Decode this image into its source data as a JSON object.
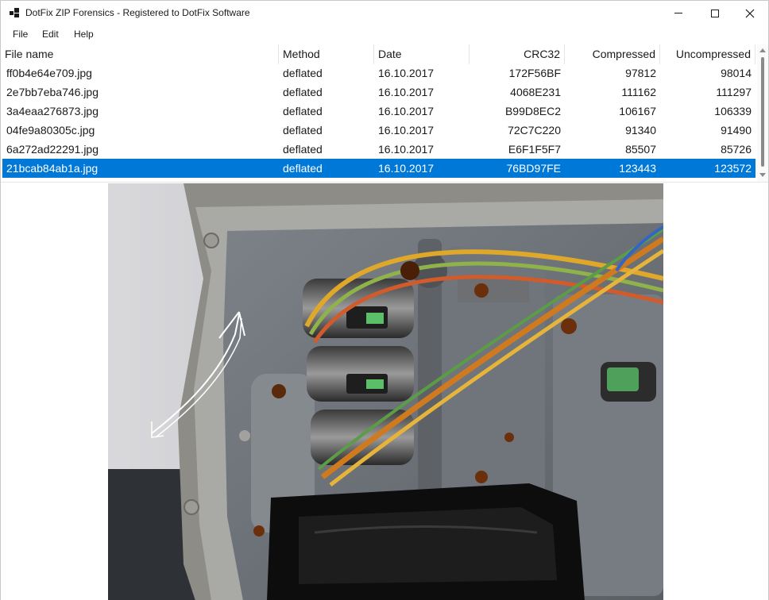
{
  "window": {
    "title": "DotFix ZIP Forensics - Registered to DotFix Software"
  },
  "menu": {
    "items": [
      "File",
      "Edit",
      "Help"
    ]
  },
  "list": {
    "columns": [
      "File name",
      "Method",
      "Date",
      "CRC32",
      "Compressed",
      "Uncompressed"
    ],
    "rows": [
      {
        "name": "ff0b4e64e709.jpg",
        "method": "deflated",
        "date": "16.10.2017",
        "crc": "172F56BF",
        "compressed": "97812",
        "uncompressed": "98014"
      },
      {
        "name": "2e7bb7eba746.jpg",
        "method": "deflated",
        "date": "16.10.2017",
        "crc": "4068E231",
        "compressed": "111162",
        "uncompressed": "111297"
      },
      {
        "name": "3a4eaa276873.jpg",
        "method": "deflated",
        "date": "16.10.2017",
        "crc": "B99D8EC2",
        "compressed": "106167",
        "uncompressed": "106339"
      },
      {
        "name": "04fe9a80305c.jpg",
        "method": "deflated",
        "date": "16.10.2017",
        "crc": "72C7C220",
        "compressed": "91340",
        "uncompressed": "91490"
      },
      {
        "name": "6a272ad22291.jpg",
        "method": "deflated",
        "date": "16.10.2017",
        "crc": "E6F1F5F7",
        "compressed": "85507",
        "uncompressed": "85726"
      },
      {
        "name": "21bcab84ab1a.jpg",
        "method": "deflated",
        "date": "16.10.2017",
        "crc": "76BD97FE",
        "compressed": "123443",
        "uncompressed": "123572"
      }
    ],
    "selected_row": "21bcab84ab1a.jpg",
    "selection_color": "#0078d7"
  },
  "preview": {
    "icon": "photo-preview"
  }
}
